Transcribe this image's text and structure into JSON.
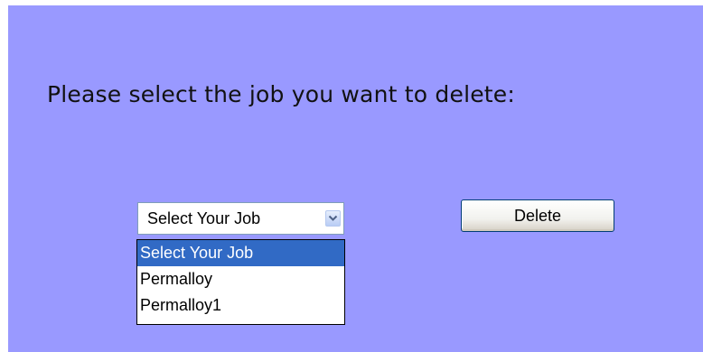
{
  "heading": "Please select the job you want to delete:",
  "job_select": {
    "selected_value": "Select Your Job",
    "options": [
      "Select Your Job",
      "Permalloy",
      "Permalloy1"
    ],
    "highlighted_index": 0
  },
  "delete_button": {
    "label": "Delete"
  },
  "colors": {
    "panel_background": "#9999ff",
    "highlight": "#316ac5"
  },
  "icons": {
    "dropdown_arrow": "chevron-down-icon"
  }
}
